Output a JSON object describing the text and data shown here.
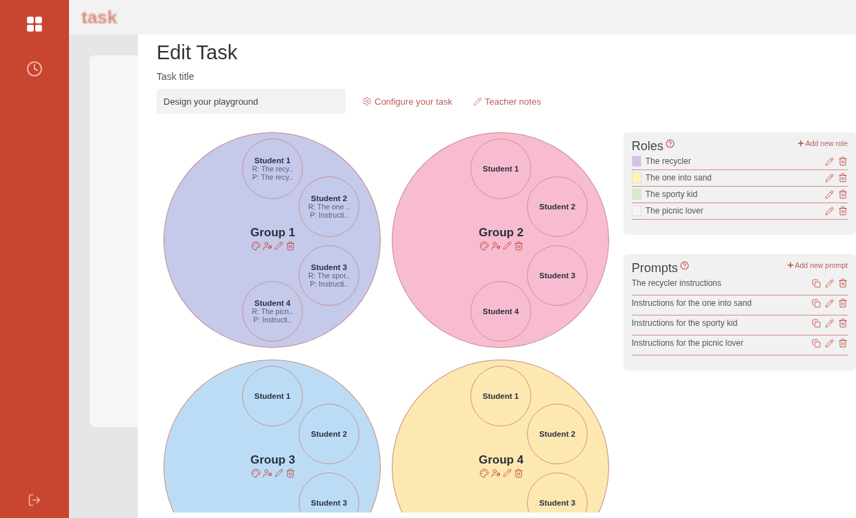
{
  "background": {
    "app_title": "task"
  },
  "modal": {
    "title": "Edit Task",
    "task_title_label": "Task title",
    "task_title_value": "Design your playground",
    "configure_link": "Configure your task",
    "notes_link": "Teacher notes"
  },
  "groups": [
    {
      "name": "Group 1",
      "color": "#c5c9ea",
      "students": [
        {
          "name": "Student 1",
          "role": "R: The recy..",
          "prompt": "P: The recy.."
        },
        {
          "name": "Student 2",
          "role": "R: The one ..",
          "prompt": "P: Instructi.."
        },
        {
          "name": "Student 3",
          "role": "R: The spor..",
          "prompt": "P: Instructi.."
        },
        {
          "name": "Student 4",
          "role": "R: The picn..",
          "prompt": "P: Instructi.."
        }
      ]
    },
    {
      "name": "Group 2",
      "color": "#f7bcd0",
      "students": [
        {
          "name": "Student 1"
        },
        {
          "name": "Student 2"
        },
        {
          "name": "Student 3"
        },
        {
          "name": "Student 4"
        }
      ]
    },
    {
      "name": "Group 3",
      "color": "#bcdcf6",
      "students": [
        {
          "name": "Student 1"
        },
        {
          "name": "Student 2"
        },
        {
          "name": "Student 3"
        }
      ]
    },
    {
      "name": "Group 4",
      "color": "#fde8b2",
      "students": [
        {
          "name": "Student 1"
        },
        {
          "name": "Student 2"
        },
        {
          "name": "Student 3"
        }
      ]
    }
  ],
  "roles": {
    "title": "Roles",
    "add_label": "Add new role",
    "items": [
      {
        "name": "The recycler",
        "color": "#d9bfe6"
      },
      {
        "name": "The one into sand",
        "color": "#fff6b0"
      },
      {
        "name": "The sporty kid",
        "color": "#d8ebc8"
      },
      {
        "name": "The picnic lover",
        "color": "#f4f4f4"
      }
    ]
  },
  "prompts": {
    "title": "Prompts",
    "add_label": "Add new prompt",
    "items": [
      "The recycler instructions",
      "Instructions for the one into sand",
      "Instructions for the sporty kid",
      "Instructions for the picnic lover"
    ]
  }
}
